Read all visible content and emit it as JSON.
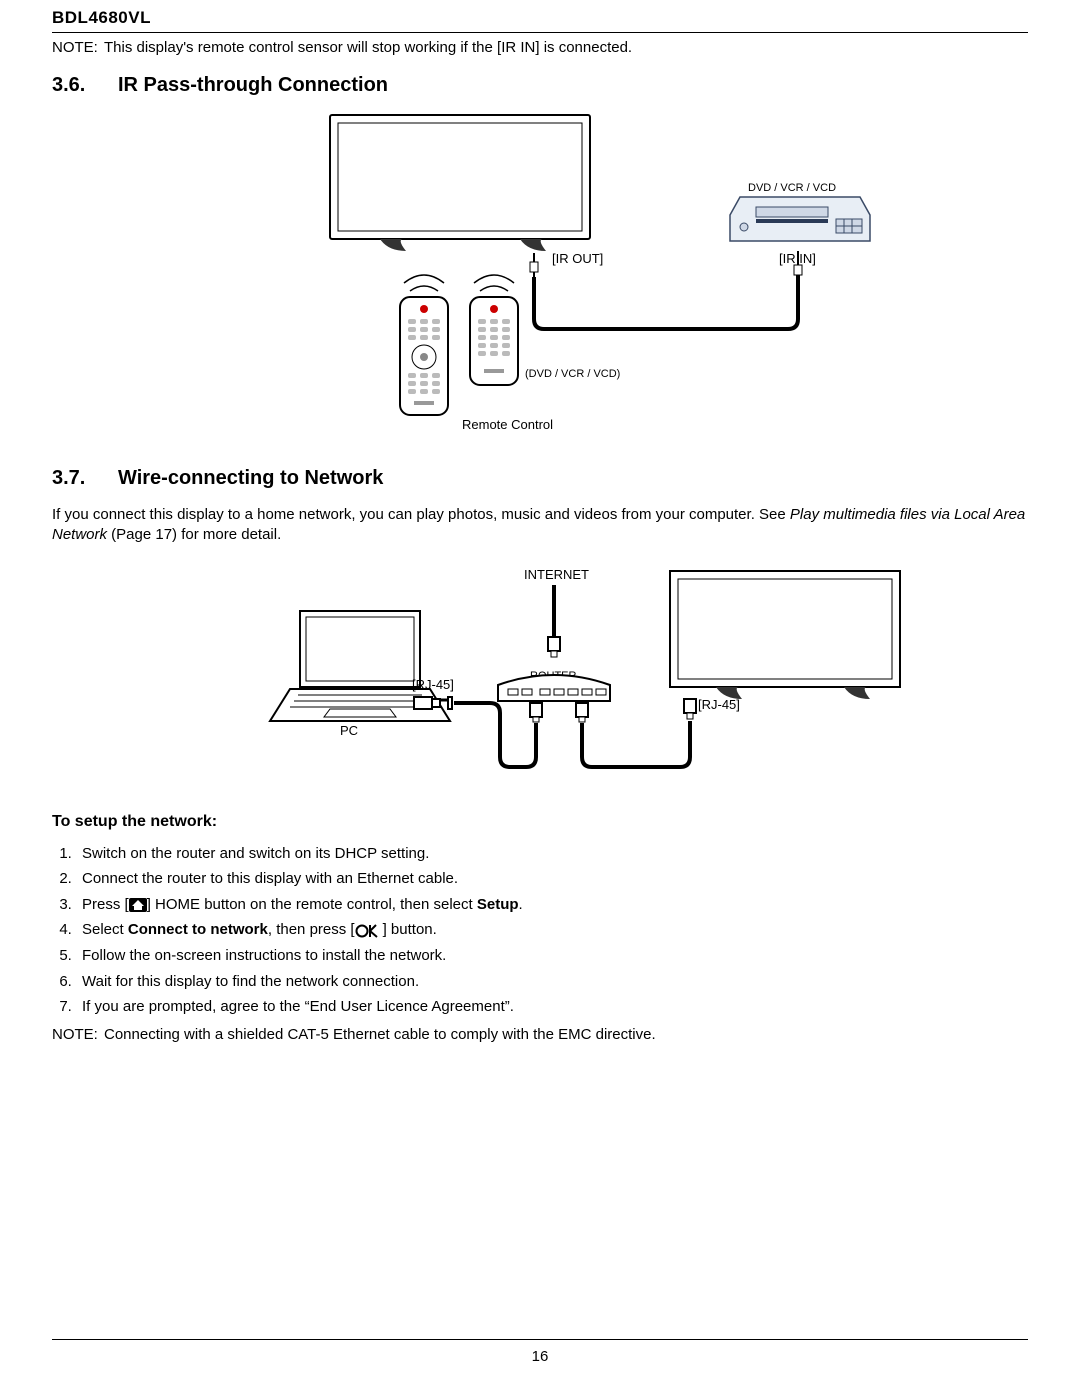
{
  "header": {
    "model": "BDL4680VL"
  },
  "note1": {
    "label": "NOTE:",
    "text_a": "This display's remote control sensor will stop working if the [",
    "text_b": "IR IN",
    "text_c": "] is connected."
  },
  "sec36": {
    "num": "3.6.",
    "title": "IR Pass-through Connection",
    "labels": {
      "dvd_top": "DVD / VCR / VCD",
      "ir_out": "[IR OUT]",
      "ir_in": "[IR IN]",
      "dvd_remote": "(DVD / VCR / VCD)",
      "remote": "Remote Control"
    }
  },
  "sec37": {
    "num": "3.7.",
    "title": "Wire-connecting to Network",
    "intro_a": "If you connect this display to a home network, you can play photos, music and videos from your computer. See ",
    "intro_b": "Play multimedia files via Local Area Network",
    "intro_c": " (Page 17) for more detail.",
    "labels": {
      "internet": "INTERNET",
      "router": "ROUTER",
      "rj45_left": "[RJ-45]",
      "rj45_right": "[RJ-45]",
      "pc": "PC"
    },
    "setup_head": "To setup the network:",
    "steps": {
      "s1": "Switch on the router and switch on its DHCP setting.",
      "s2": "Connect the router to this display with an Ethernet cable.",
      "s3a": "Press [",
      "s3b": "] HOME button on the remote control, then select ",
      "s3c": "Setup",
      "s3d": ".",
      "s4a": "Select ",
      "s4b": "Connect to network",
      "s4c": ", then press [",
      "s4d": "] button.",
      "s5": "Follow the on-screen instructions to install the network.",
      "s6": "Wait for this display to find the network connection.",
      "s7a": "If you are prompted, agree to the “",
      "s7b": "End User Licence Agreement",
      "s7c": "”."
    },
    "note2": {
      "label": "NOTE:",
      "text": "Connecting with a shielded CAT-5 Ethernet cable to comply with the EMC directive."
    }
  },
  "footer": {
    "page": "16"
  }
}
